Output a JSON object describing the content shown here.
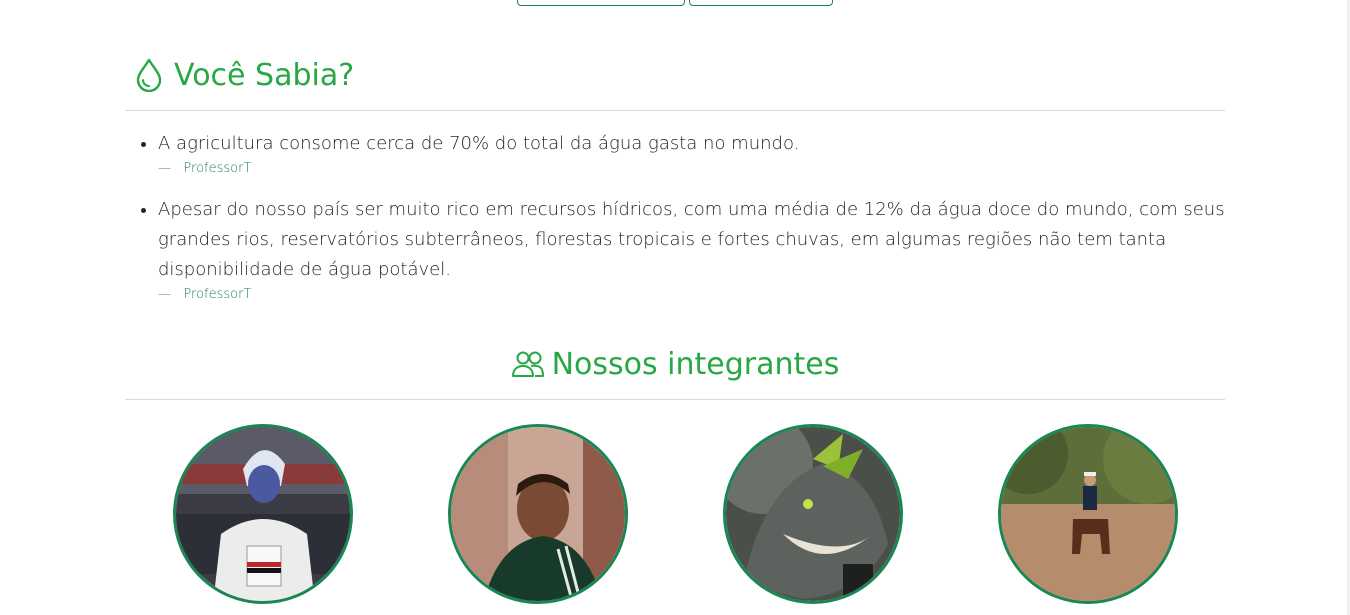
{
  "did_you_know": {
    "title": "Você Sabia?",
    "facts": [
      {
        "text": "A agricultura consome cerca de 70% do total da água gasta no mundo.",
        "dash": "—",
        "author": "ProfessorT"
      },
      {
        "text": "Apesar do nosso país ser muito rico em recursos hídricos, com uma média de 12% da água doce do mundo, com seus grandes rios, reservatórios subterrâneos, florestas tropicais e fortes chuvas, em algumas regiões não tem tanta disponibilidade de água potável.",
        "dash": "—",
        "author": "ProfessorT"
      }
    ]
  },
  "members": {
    "title": "Nossos integrantes"
  },
  "colors": {
    "accent": "#28a745",
    "border": "#198754"
  },
  "icons": {
    "title_icon": "droplet-icon",
    "members_icon": "people-icon"
  }
}
